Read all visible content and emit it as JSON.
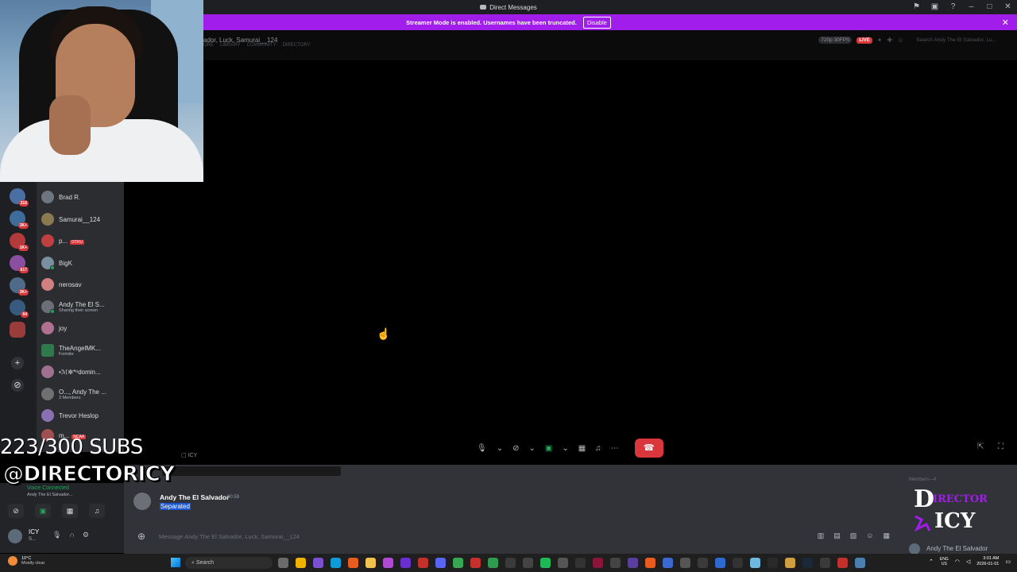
{
  "window": {
    "title": "Direct Messages"
  },
  "banner": {
    "message": "Streamer Mode is enabled. Usernames have been truncated.",
    "button": "Disable"
  },
  "stream": {
    "participants": "ador, Luck, Samurai__124",
    "nav": [
      "ORE",
      "LIBRARY",
      "COMMUNITY",
      "DIRECTORY"
    ],
    "quality": "720p 30FPS",
    "live": "LIVE",
    "search_placeholder": "Search Andy The El Salvador, Lu..."
  },
  "rail": {
    "badges": [
      "316",
      "3K+",
      "1K+",
      "617",
      "3K+",
      "64"
    ]
  },
  "dms": [
    {
      "name": "Brad R.",
      "sub": ""
    },
    {
      "name": "Samurai__124",
      "sub": ""
    },
    {
      "name": "p...",
      "sub": "",
      "tag": "OTKU"
    },
    {
      "name": "BigK",
      "sub": ""
    },
    {
      "name": "nerosav",
      "sub": ""
    },
    {
      "name": "Andy The El S...",
      "sub": "Sharing their screen"
    },
    {
      "name": "joy",
      "sub": ""
    },
    {
      "name": "TheAngelMK...",
      "sub": "Fortnite"
    },
    {
      "name": "•ℳ✼*ᵒdomin...",
      "sub": ""
    },
    {
      "name": "O..., Andy The ...",
      "sub": "3 Members"
    },
    {
      "name": "Trevor Heslop",
      "sub": ""
    },
    {
      "name": "m...",
      "sub": "NCAA"
    }
  ],
  "overlay": {
    "subs": "223/300 SUBS",
    "handle": "@DIRECTORICY"
  },
  "voice": {
    "status": "Voice Connected",
    "channel": "Andy The El Salvador..."
  },
  "user": {
    "name": "ICY",
    "status": "S..."
  },
  "chat": {
    "channel": "ICY",
    "author": "Andy The El Salvador",
    "time": "00:59",
    "message": "Separated",
    "placeholder": "Message Andy The El Salvador, Luck, Samurai__124",
    "members_header": "Members—4",
    "member": "Andy The El Salvador"
  },
  "taskbar": {
    "temp": "10°C",
    "condition": "Mostly clear",
    "search": "Search",
    "lang1": "ENG",
    "lang2": "US",
    "time": "3:01 AM",
    "date": "2026-01-01"
  },
  "colors": {
    "banner": "#a11de9",
    "hangup": "#da373c",
    "online": "#23a55a",
    "selection": "#1c56cf"
  }
}
